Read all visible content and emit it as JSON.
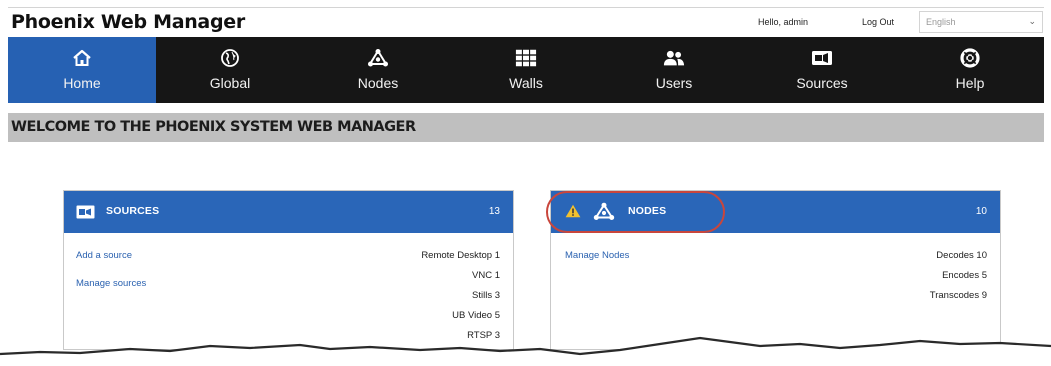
{
  "app": {
    "title": "Phoenix Web Manager",
    "greeting": "Hello, admin",
    "logout_label": "Log Out",
    "language": {
      "selected": "English"
    }
  },
  "nav": {
    "items": [
      {
        "label": "Home",
        "icon": "home-icon",
        "active": true
      },
      {
        "label": "Global",
        "icon": "globe-icon"
      },
      {
        "label": "Nodes",
        "icon": "nodes-icon"
      },
      {
        "label": "Walls",
        "icon": "walls-grid-icon"
      },
      {
        "label": "Users",
        "icon": "users-icon"
      },
      {
        "label": "Sources",
        "icon": "camera-icon"
      },
      {
        "label": "Help",
        "icon": "lifebuoy-icon"
      }
    ]
  },
  "welcome": {
    "title": "WELCOME TO THE PHOENIX SYSTEM WEB MANAGER"
  },
  "sources_card": {
    "title": "SOURCES",
    "count": "13",
    "icon": "camera-icon",
    "links": [
      "Add a source",
      "Manage sources"
    ],
    "stats": [
      "Remote Desktop 1",
      "VNC 1",
      "Stills 3",
      "UB Video 5",
      "RTSP 3"
    ]
  },
  "nodes_card": {
    "title": "NODES",
    "count": "10",
    "icon": "nodes-icon",
    "warning_icon": "warning-icon",
    "links": [
      "Manage Nodes"
    ],
    "stats": [
      "Decodes 10",
      "Encodes 5",
      "Transcodes 9"
    ]
  },
  "colors": {
    "accent": "#2661b3",
    "navbar": "#161616",
    "card_header": "#2a66b8",
    "link": "#2b62b0",
    "warning": "#f2c12e",
    "callout": "#c9463c"
  }
}
